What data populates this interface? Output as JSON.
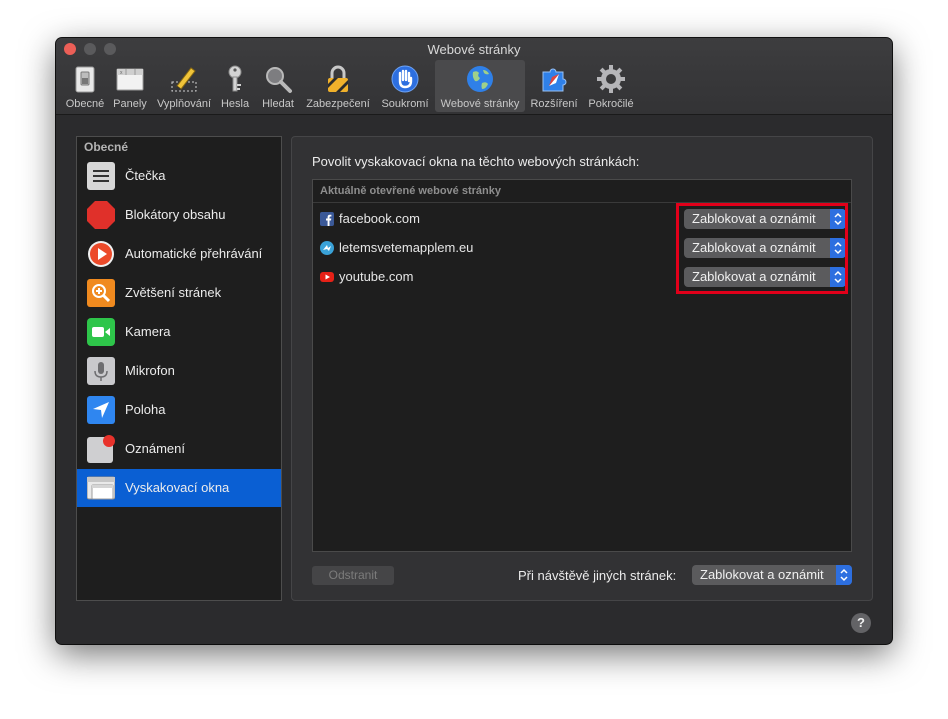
{
  "window": {
    "title": "Webové stránky"
  },
  "toolbar": {
    "items": [
      {
        "label": "Obecné",
        "icon": "switch-icon"
      },
      {
        "label": "Panely",
        "icon": "tabs-icon"
      },
      {
        "label": "Vyplňování",
        "icon": "pencil-icon"
      },
      {
        "label": "Hesla",
        "icon": "key-icon"
      },
      {
        "label": "Hledat",
        "icon": "magnifier-icon"
      },
      {
        "label": "Zabezpečení",
        "icon": "lock-icon"
      },
      {
        "label": "Soukromí",
        "icon": "hand-icon"
      },
      {
        "label": "Webové stránky",
        "icon": "globe-icon"
      },
      {
        "label": "Rozšíření",
        "icon": "puzzle-icon"
      },
      {
        "label": "Pokročilé",
        "icon": "gear-icon"
      }
    ],
    "active": "Webové stránky"
  },
  "sidebar": {
    "header": "Obecné",
    "items": [
      {
        "label": "Čtečka",
        "icon": "reader-icon"
      },
      {
        "label": "Blokátory obsahu",
        "icon": "stop-sign-icon"
      },
      {
        "label": "Automatické přehrávání",
        "icon": "play-icon"
      },
      {
        "label": "Zvětšení stránek",
        "icon": "zoom-icon"
      },
      {
        "label": "Kamera",
        "icon": "camera-icon"
      },
      {
        "label": "Mikrofon",
        "icon": "microphone-icon"
      },
      {
        "label": "Poloha",
        "icon": "location-icon"
      },
      {
        "label": "Oznámení",
        "icon": "notification-icon"
      },
      {
        "label": "Vyskakovací okna",
        "icon": "popup-windows-icon"
      }
    ],
    "selected": "Vyskakovací okna"
  },
  "main": {
    "title": "Povolit vyskakovací okna na těchto webových stránkách:",
    "table_header": "Aktuálně otevřené webové stránky",
    "rows": [
      {
        "site": "facebook.com",
        "icon": "facebook-icon",
        "setting": "Zablokovat a oznámit"
      },
      {
        "site": "letemsvetemapplem.eu",
        "icon": "letemsvetemapplem-icon",
        "setting": "Zablokovat a oznámit"
      },
      {
        "site": "youtube.com",
        "icon": "youtube-icon",
        "setting": "Zablokovat a oznámit"
      }
    ],
    "remove_button": "Odstranit",
    "other_sites_label": "Při návštěvě jiných stránek:",
    "other_sites_setting": "Zablokovat a oznámit"
  },
  "help": "?",
  "colors": {
    "accent": "#0a5fd3",
    "highlight_border": "#e2001a",
    "popup_arrow": "#2d6fe0"
  }
}
